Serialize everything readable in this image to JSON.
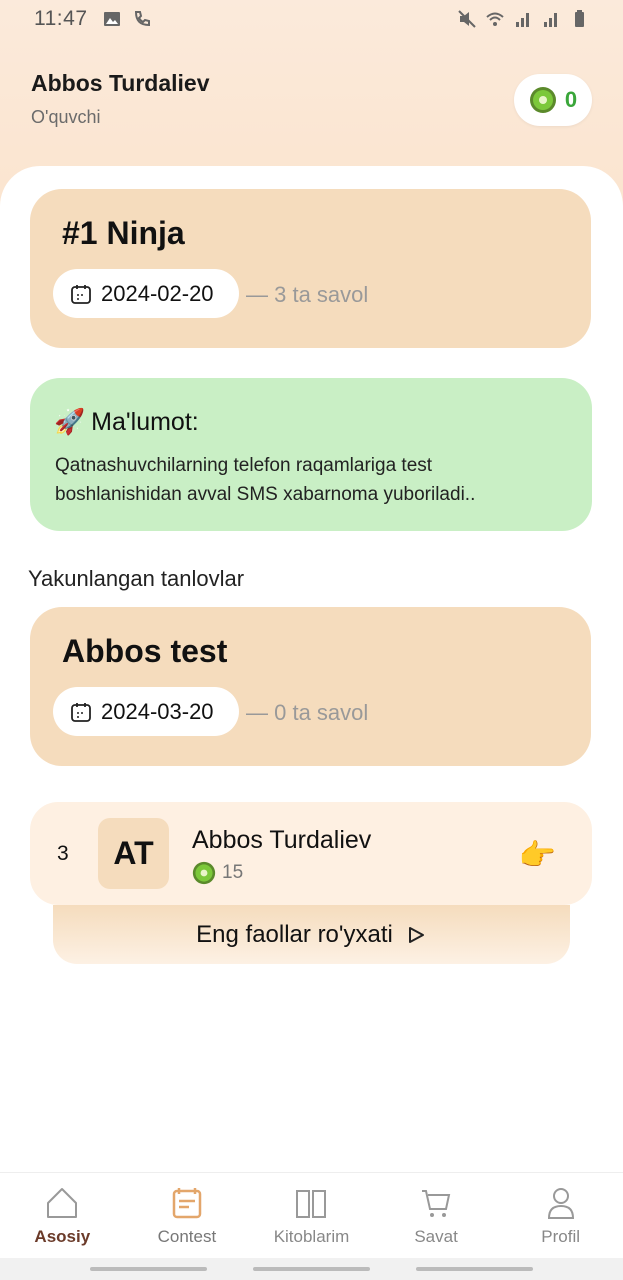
{
  "status_bar": {
    "time": "11:47"
  },
  "header": {
    "user_name": "Abbos Turdaliev",
    "user_role": "O'quvchi",
    "coins": "0"
  },
  "current_contest": {
    "title": "#1 Ninja",
    "date": "2024-02-20",
    "question_count": "— 3 ta savol"
  },
  "info": {
    "title": "Ma'lumot:",
    "body": "Qatnashuvchilarning telefon raqamlariga test boshlanishidan avval SMS xabarnoma yuboriladi.."
  },
  "finished_section": {
    "label": "Yakunlangan tanlovlar"
  },
  "finished_contest": {
    "title": "Abbos test",
    "date": "2024-03-20",
    "question_count": "— 0 ta savol"
  },
  "leaderboard": {
    "rank": "3",
    "initials": "AT",
    "name": "Abbos Turdaliev",
    "score": "15",
    "button_label": "Eng faollar ro'yxati"
  },
  "nav": [
    {
      "label": "Asosiy",
      "icon": "home-icon"
    },
    {
      "label": "Contest",
      "icon": "contest-icon"
    },
    {
      "label": "Kitoblarim",
      "icon": "book-icon"
    },
    {
      "label": "Savat",
      "icon": "cart-icon"
    },
    {
      "label": "Profil",
      "icon": "profile-icon"
    }
  ],
  "colors": {
    "accent": "#f5dcbd",
    "info_bg": "#c9efc5",
    "coin_green": "#3aa63a",
    "active_nav": "#6b3b2a"
  }
}
